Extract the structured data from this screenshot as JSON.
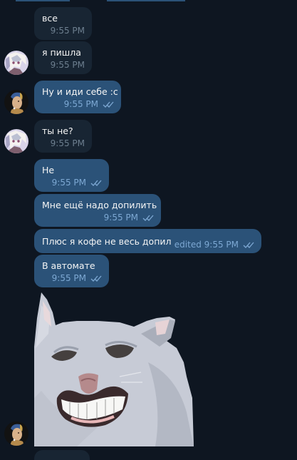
{
  "messages": [
    {
      "text": "все",
      "time": "9:55 PM"
    },
    {
      "text": "я пишла",
      "time": "9:55 PM"
    },
    {
      "text": "Ну и иди себе :с",
      "time": "9:55 PM"
    },
    {
      "text": "ты не?",
      "time": "9:55 PM"
    },
    {
      "text": "Не",
      "time": "9:55 PM"
    },
    {
      "text": "Мне ещё надо допилить",
      "time": "9:55 PM"
    },
    {
      "text": "Плюс я кофе не весь допил",
      "time": "edited 9:55 PM"
    },
    {
      "text": "В автомате",
      "time": "9:55 PM"
    }
  ],
  "icons": {
    "read_receipt": "double-check-icon",
    "avatar_a": "anime-avatar",
    "avatar_b": "painting-avatar"
  },
  "colors": {
    "background": "#0e1621",
    "incoming_bubble": "#182533",
    "outgoing_bubble": "#2b5278",
    "time_incoming": "#6d7f8f",
    "time_outgoing": "#7da8d3"
  }
}
